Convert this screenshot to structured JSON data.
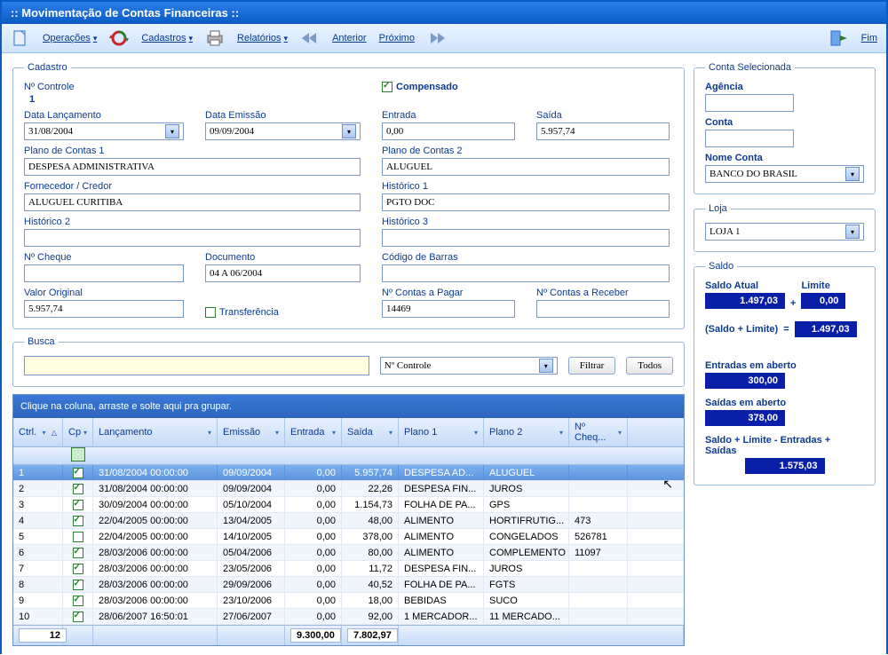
{
  "window": {
    "title": ":: Movimentação de Contas Financeiras ::"
  },
  "toolbar": {
    "operacoes": "Operações",
    "cadastros": "Cadastros",
    "relatorios": "Relatórios",
    "anterior": "Anterior",
    "proximo": "Próximo",
    "fim": "Fim"
  },
  "cadastro": {
    "legend": "Cadastro",
    "controle_label": "Nº Controle",
    "controle_value": "1",
    "compensado_label": "Compensado",
    "compensado_checked": true,
    "data_lanc_label": "Data Lançamento",
    "data_lanc": "31/08/2004",
    "data_emis_label": "Data Emissão",
    "data_emis": "09/09/2004",
    "entrada_label": "Entrada",
    "entrada": "0,00",
    "saida_label": "Saída",
    "saida": "5.957,74",
    "plano1_label": "Plano de Contas 1",
    "plano1": "DESPESA ADMINISTRATIVA",
    "plano2_label": "Plano de Contas 2",
    "plano2": "ALUGUEL",
    "forn_label": "Fornecedor / Credor",
    "forn": "ALUGUEL CURITIBA",
    "hist1_label": "Histórico 1",
    "hist1": "PGTO DOC",
    "hist2_label": "Histórico 2",
    "hist2": "",
    "hist3_label": "Histórico 3",
    "hist3": "",
    "cheque_label": "Nº Cheque",
    "cheque": "",
    "doc_label": "Documento",
    "doc": "04 A 06/2004",
    "barras_label": "Código de Barras",
    "barras": "",
    "valor_label": "Valor Original",
    "valor": "5.957,74",
    "transf_label": "Transferência",
    "cp_label": "Nº Contas a Pagar",
    "cp": "14469",
    "cr_label": "Nº Contas a Receber",
    "cr": ""
  },
  "busca": {
    "legend": "Busca",
    "combo": "Nº Controle",
    "filtrar": "Filtrar",
    "todos": "Todos"
  },
  "grid": {
    "hint": "Clique na coluna, arraste e solte aqui pra grupar.",
    "cols": [
      "Ctrl.",
      "Cp",
      "Lançamento",
      "Emissão",
      "Entrada",
      "Saída",
      "Plano 1",
      "Plano 2",
      "Nº Cheq..."
    ],
    "rows": [
      {
        "ctrl": "1",
        "cp": true,
        "lanc": "31/08/2004 00:00:00",
        "emis": "09/09/2004",
        "ent": "0,00",
        "sai": "5.957,74",
        "p1": "DESPESA AD...",
        "p2": "ALUGUEL",
        "chq": ""
      },
      {
        "ctrl": "2",
        "cp": true,
        "lanc": "31/08/2004 00:00:00",
        "emis": "09/09/2004",
        "ent": "0,00",
        "sai": "22,26",
        "p1": "DESPESA FIN...",
        "p2": "JUROS",
        "chq": ""
      },
      {
        "ctrl": "3",
        "cp": true,
        "lanc": "30/09/2004 00:00:00",
        "emis": "05/10/2004",
        "ent": "0,00",
        "sai": "1.154,73",
        "p1": "FOLHA DE PA...",
        "p2": "GPS",
        "chq": ""
      },
      {
        "ctrl": "4",
        "cp": true,
        "lanc": "22/04/2005 00:00:00",
        "emis": "13/04/2005",
        "ent": "0,00",
        "sai": "48,00",
        "p1": "ALIMENTO",
        "p2": "HORTIFRUTIG...",
        "chq": "473"
      },
      {
        "ctrl": "5",
        "cp": false,
        "lanc": "22/04/2005 00:00:00",
        "emis": "14/10/2005",
        "ent": "0,00",
        "sai": "378,00",
        "p1": "ALIMENTO",
        "p2": "CONGELADOS",
        "chq": "526781"
      },
      {
        "ctrl": "6",
        "cp": true,
        "lanc": "28/03/2006 00:00:00",
        "emis": "05/04/2006",
        "ent": "0,00",
        "sai": "80,00",
        "p1": "ALIMENTO",
        "p2": "COMPLEMENTO",
        "chq": "11097"
      },
      {
        "ctrl": "7",
        "cp": true,
        "lanc": "28/03/2006 00:00:00",
        "emis": "23/05/2006",
        "ent": "0,00",
        "sai": "11,72",
        "p1": "DESPESA FIN...",
        "p2": "JUROS",
        "chq": ""
      },
      {
        "ctrl": "8",
        "cp": true,
        "lanc": "28/03/2006 00:00:00",
        "emis": "29/09/2006",
        "ent": "0,00",
        "sai": "40,52",
        "p1": "FOLHA DE PA...",
        "p2": "FGTS",
        "chq": ""
      },
      {
        "ctrl": "9",
        "cp": true,
        "lanc": "28/03/2006 00:00:00",
        "emis": "23/10/2006",
        "ent": "0,00",
        "sai": "18,00",
        "p1": "BEBIDAS",
        "p2": "SUCO",
        "chq": ""
      },
      {
        "ctrl": "10",
        "cp": true,
        "lanc": "28/06/2007 16:50:01",
        "emis": "27/06/2007",
        "ent": "0,00",
        "sai": "92,00",
        "p1": "1 MERCADOR...",
        "p2": "11 MERCADO...",
        "chq": ""
      }
    ],
    "foot_count": "12",
    "foot_ent": "9.300,00",
    "foot_sai": "7.802,97"
  },
  "conta": {
    "legend": "Conta Selecionada",
    "agencia_label": "Agência",
    "conta_label": "Conta",
    "nome_label": "Nome Conta",
    "nome": "BANCO DO BRASIL"
  },
  "loja": {
    "legend": "Loja",
    "loja": "LOJA 1"
  },
  "saldo": {
    "legend": "Saldo",
    "atual_label": "Saldo Atual",
    "atual": "1.497,03",
    "limite_label": "Limite",
    "limite": "0,00",
    "soma_label": "(Saldo + Limite)",
    "soma": "1.497,03",
    "ea_label": "Entradas em aberto",
    "ea": "300,00",
    "sa_label": "Saídas em aberto",
    "sa": "378,00",
    "final_label": "Saldo + Limite - Entradas + Saídas",
    "final": "1.575,03"
  }
}
